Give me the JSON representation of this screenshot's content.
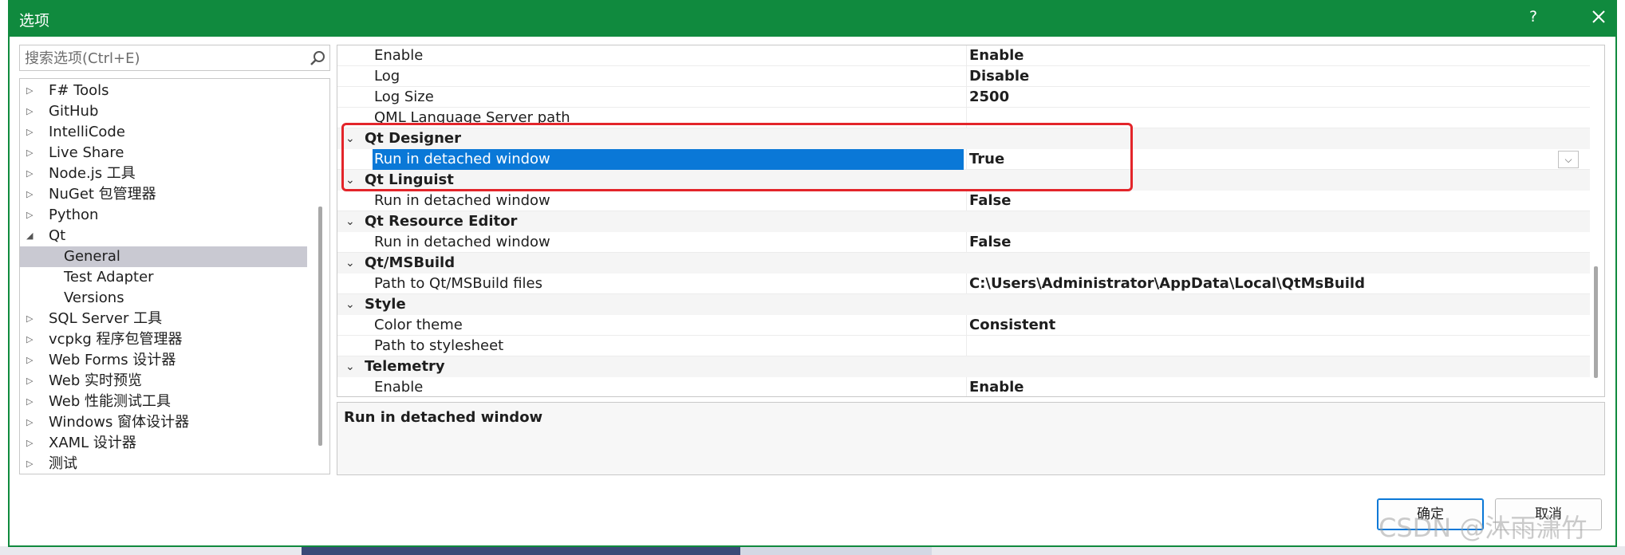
{
  "window": {
    "title": "选项",
    "help_label": "?"
  },
  "search": {
    "placeholder": "搜索选项(Ctrl+E)"
  },
  "tree": {
    "items": [
      {
        "label": "F# Tools",
        "expander": "▷"
      },
      {
        "label": "GitHub",
        "expander": "▷"
      },
      {
        "label": "IntelliCode",
        "expander": "▷"
      },
      {
        "label": "Live Share",
        "expander": "▷"
      },
      {
        "label": "Node.js 工具",
        "expander": "▷"
      },
      {
        "label": "NuGet 包管理器",
        "expander": "▷"
      },
      {
        "label": "Python",
        "expander": "▷"
      },
      {
        "label": "Qt",
        "expander": "◢"
      },
      {
        "label": "General",
        "expander": ""
      },
      {
        "label": "Test Adapter",
        "expander": ""
      },
      {
        "label": "Versions",
        "expander": ""
      },
      {
        "label": "SQL Server 工具",
        "expander": "▷"
      },
      {
        "label": "vcpkg 程序包管理器",
        "expander": "▷"
      },
      {
        "label": "Web Forms 设计器",
        "expander": "▷"
      },
      {
        "label": "Web 实时预览",
        "expander": "▷"
      },
      {
        "label": "Web 性能测试工具",
        "expander": "▷"
      },
      {
        "label": "Windows 窗体设计器",
        "expander": "▷"
      },
      {
        "label": "XAML 设计器",
        "expander": "▷"
      },
      {
        "label": "测试",
        "expander": "▷"
      }
    ],
    "selected": "General"
  },
  "grid": {
    "rows": [
      {
        "name": "Enable",
        "value": "Enable"
      },
      {
        "name": "Log",
        "value": "Disable"
      },
      {
        "name": "Log Size",
        "value": "2500"
      },
      {
        "name": "QML Language Server path",
        "value": ""
      },
      {
        "category": "Qt Designer"
      },
      {
        "name": "Run in detached window",
        "value": "True"
      },
      {
        "category": "Qt Linguist"
      },
      {
        "name": "Run in detached window",
        "value": "False"
      },
      {
        "category": "Qt Resource Editor"
      },
      {
        "name": "Run in detached window",
        "value": "False"
      },
      {
        "category": "Qt/MSBuild"
      },
      {
        "name": "Path to Qt/MSBuild files",
        "value": "C:\\Users\\Administrator\\AppData\\Local\\QtMsBuild"
      },
      {
        "category": "Style"
      },
      {
        "name": "Color theme",
        "value": "Consistent"
      },
      {
        "name": "Path to stylesheet",
        "value": ""
      },
      {
        "category": "Telemetry"
      },
      {
        "name": "Enable",
        "value": "Enable"
      }
    ],
    "selected_row": "Run in detached window",
    "category_chevron": "⌄"
  },
  "description": {
    "title": "Run in detached window"
  },
  "buttons": {
    "ok": "确定",
    "cancel": "取消"
  },
  "watermark": "CSDN @沐雨潇竹",
  "colors": {
    "titlebar": "#108a3e",
    "selection": "#0a78d7",
    "highlight_box": "#e3252a"
  }
}
